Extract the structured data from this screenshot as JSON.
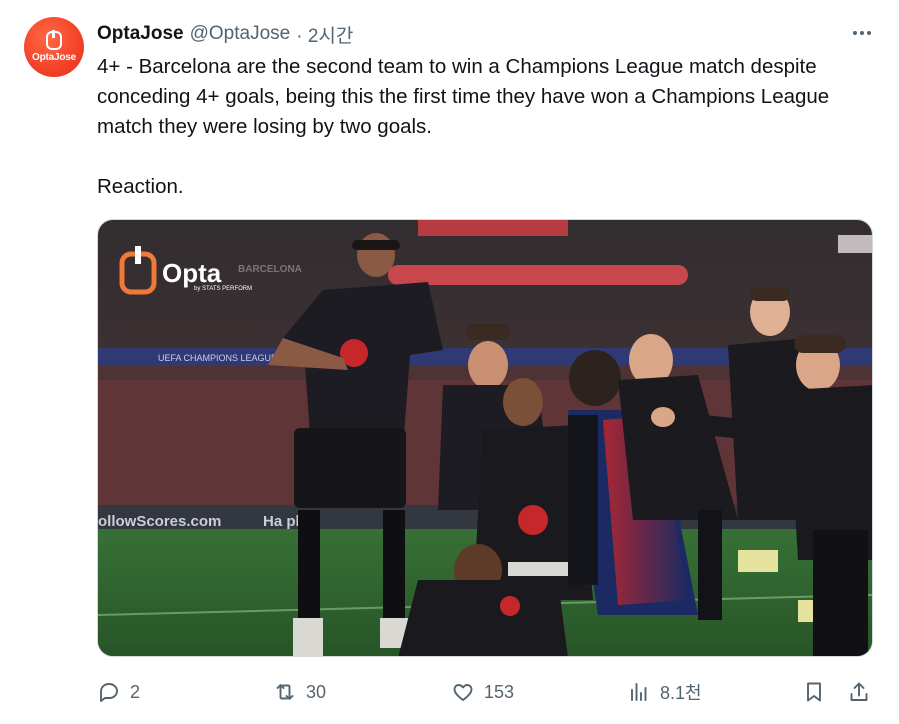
{
  "author": {
    "name": "OptaJose",
    "handle": "@OptaJose",
    "time": "· 2시간",
    "avatar_text": "OptaJose"
  },
  "tweet": {
    "line1": "4+ - Barcelona are the second team to win a Champions League match despite conceding 4+ goals, being this the first time they have won a Champions League match they were losing by two goals.",
    "line2": "Reaction."
  },
  "media": {
    "watermark": "Opta",
    "watermark_sub": "by STATS PERFORM",
    "board_text": "ollowScores.com",
    "board_text2": "Ha  pke",
    "banner_text": "UEFA CHAMPIONS LEAGUE",
    "board_top": "BARCELONA"
  },
  "actions": {
    "replies": "2",
    "retweets": "30",
    "likes": "153",
    "views": "8.1천"
  },
  "icons": [
    "more-icon",
    "reply-icon",
    "retweet-icon",
    "like-icon",
    "views-icon",
    "bookmark-icon",
    "share-icon"
  ]
}
